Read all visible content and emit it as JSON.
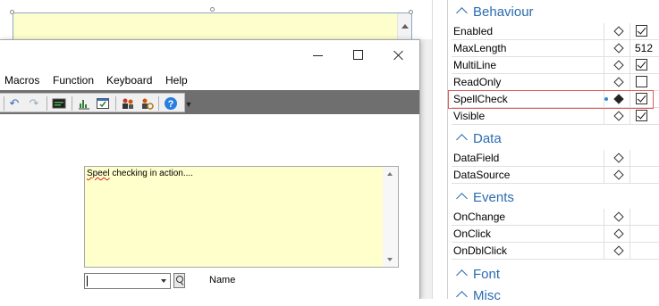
{
  "designer": {
    "menu": [
      "Macros",
      "Function",
      "Keyboard",
      "Help"
    ],
    "toolbar_icons": [
      "undo-icon",
      "redo-icon",
      "terminal-icon",
      "chart-icon",
      "form-check-icon",
      "users-icon",
      "user-settings-icon",
      "help-icon",
      "toolbar-overflow-icon"
    ],
    "memo_text_typo": "Speel",
    "memo_text_rest": " checking in action....",
    "name_label": "Name"
  },
  "properties": {
    "sections": {
      "behaviour": "Behaviour",
      "data": "Data",
      "events": "Events",
      "font": "Font",
      "misc": "Misc"
    },
    "behaviour_rows": [
      {
        "name": "Enabled",
        "type": "check",
        "checked": true
      },
      {
        "name": "MaxLength",
        "type": "text",
        "value": "512"
      },
      {
        "name": "MultiLine",
        "type": "check",
        "checked": true
      },
      {
        "name": "ReadOnly",
        "type": "check",
        "checked": false
      },
      {
        "name": "SpellCheck",
        "type": "check",
        "checked": true,
        "modified": true
      },
      {
        "name": "Visible",
        "type": "check",
        "checked": true
      }
    ],
    "data_rows": [
      {
        "name": "DataField"
      },
      {
        "name": "DataSource"
      }
    ],
    "event_rows": [
      {
        "name": "OnChange"
      },
      {
        "name": "OnClick"
      },
      {
        "name": "OnDblClick"
      }
    ]
  },
  "colors": {
    "section_accent": "#2b6cb0",
    "memo_background": "#ffffcc",
    "highlight_border": "#e05a5a"
  }
}
